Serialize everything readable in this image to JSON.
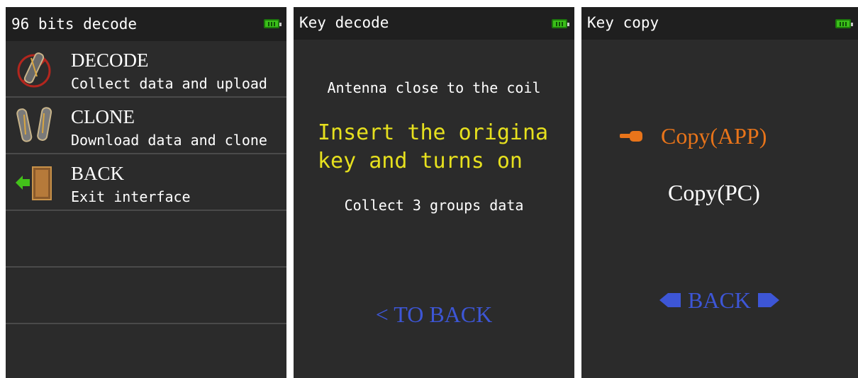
{
  "screen1": {
    "title": "96 bits decode",
    "items": [
      {
        "title": "DECODE",
        "subtitle": "Collect data and upload",
        "icon": "decode-chip-icon"
      },
      {
        "title": "CLONE",
        "subtitle": "Download data and clone",
        "icon": "clone-chips-icon"
      },
      {
        "title": "BACK",
        "subtitle": "Exit interface",
        "icon": "exit-door-icon"
      }
    ]
  },
  "screen2": {
    "title": "Key decode",
    "line1": "Antenna close to the coil",
    "highlight_line1": "Insert the origina",
    "highlight_line2": "key and turns on",
    "line2": "Collect 3 groups data",
    "back_label": "< TO BACK"
  },
  "screen3": {
    "title": "Key copy",
    "option_app": "Copy(APP)",
    "option_pc": "Copy(PC)",
    "back_label": "BACK"
  },
  "colors": {
    "screen_bg": "#2b2b2b",
    "titlebar_bg": "#1f1f1f",
    "highlight_yellow": "#e6e01e",
    "link_blue": "#3d56d6",
    "selected_orange": "#e8741a",
    "battery_green": "#3bbf1a"
  }
}
